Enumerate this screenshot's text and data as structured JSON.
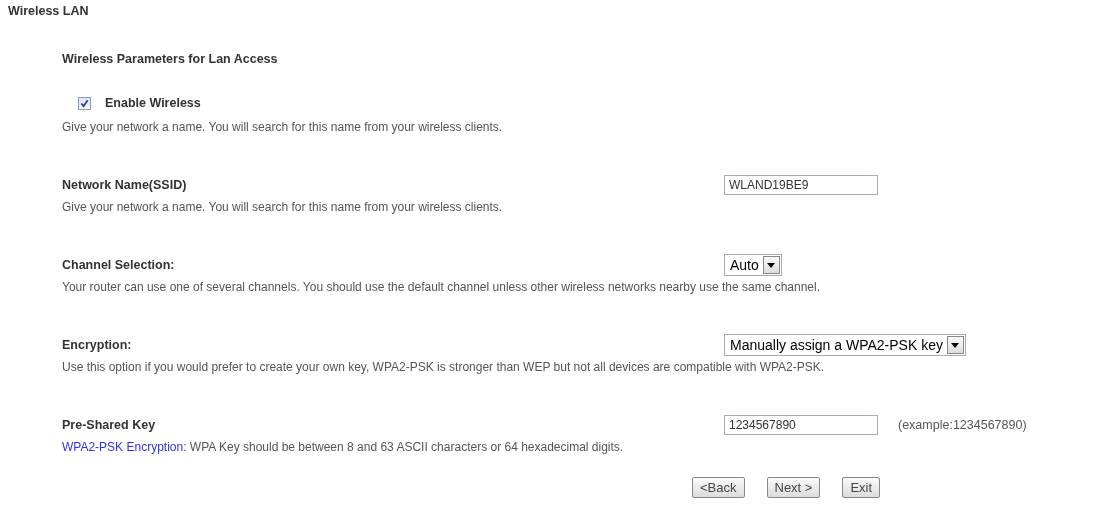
{
  "title": "Wireless LAN",
  "subtitle": "Wireless Parameters for Lan Access",
  "enable": {
    "label": "Enable Wireless",
    "checked": true
  },
  "enable_hint": "Give your network a name. You will search for this name from your wireless clients.",
  "fields": [
    {
      "kind": "text",
      "label": "Network Name(SSID)",
      "value": "WLAND19BE9",
      "hint": "Give your network a name. You will search for this name from your wireless clients."
    },
    {
      "kind": "select",
      "label": "Channel Selection:",
      "value": "Auto",
      "hint": "Your router can use one of several channels. You should use the default channel unless other wireless networks nearby use the same channel."
    },
    {
      "kind": "select",
      "label": "Encryption:",
      "value": "Manually assign a WPA2-PSK key",
      "hint": "Use this option if you would prefer to create your own key, WPA2-PSK is stronger than WEP but not all devices are compatible with WPA2-PSK."
    },
    {
      "kind": "text",
      "label": "Pre-Shared Key",
      "value": "1234567890",
      "note": "(example:1234567890)",
      "hint_prefix": "WPA2-PSK Encryption:",
      "hint": "WPA Key should be between 8 and 63 ASCII characters or 64 hexadecimal digits."
    }
  ],
  "buttons": [
    "<Back",
    "Next >",
    "Exit"
  ]
}
